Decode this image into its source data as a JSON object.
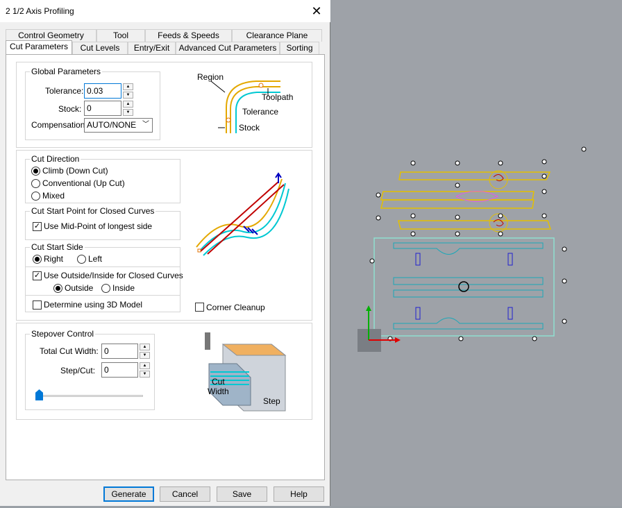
{
  "window": {
    "title": "2 1/2 Axis Profiling",
    "close": "✕"
  },
  "tabs_row1": [
    "Control Geometry",
    "Tool",
    "Feeds & Speeds",
    "Clearance Plane"
  ],
  "tabs_row2": [
    "Cut Parameters",
    "Cut Levels",
    "Entry/Exit",
    "Advanced Cut Parameters",
    "Sorting"
  ],
  "global": {
    "title": "Global Parameters",
    "tolerance_label": "Tolerance:",
    "tolerance_value": "0.03",
    "stock_label": "Stock:",
    "stock_value": "0",
    "compensation_label": "Compensation:",
    "compensation_value": "AUTO/NONE"
  },
  "diagram1": {
    "region": "Region",
    "toolpath": "Toolpath",
    "tolerance": "Tolerance",
    "stock": "Stock"
  },
  "cut_direction": {
    "title": "Cut Direction",
    "options": [
      "Climb (Down Cut)",
      "Conventional (Up Cut)",
      "Mixed"
    ]
  },
  "cut_start_point": {
    "title": "Cut Start Point for Closed Curves",
    "midpoint_label": "Use Mid-Point of longest side"
  },
  "cut_start_side": {
    "title": "Cut Start Side",
    "right": "Right",
    "left": "Left",
    "use_outside_inside": "Use Outside/Inside for Closed Curves",
    "outside": "Outside",
    "inside": "Inside",
    "determine_3d": "Determine using 3D Model"
  },
  "corner_cleanup": "Corner Cleanup",
  "stepover": {
    "title": "Stepover Control",
    "total_cut_width_label": "Total Cut Width:",
    "total_cut_width_value": "0",
    "step_cut_label": "Step/Cut:",
    "step_cut_value": "0"
  },
  "diagram3": {
    "cut_width_1": "Cut",
    "cut_width_2": "Width",
    "step": "Step"
  },
  "buttons": {
    "generate": "Generate",
    "cancel": "Cancel",
    "save": "Save",
    "help": "Help"
  }
}
